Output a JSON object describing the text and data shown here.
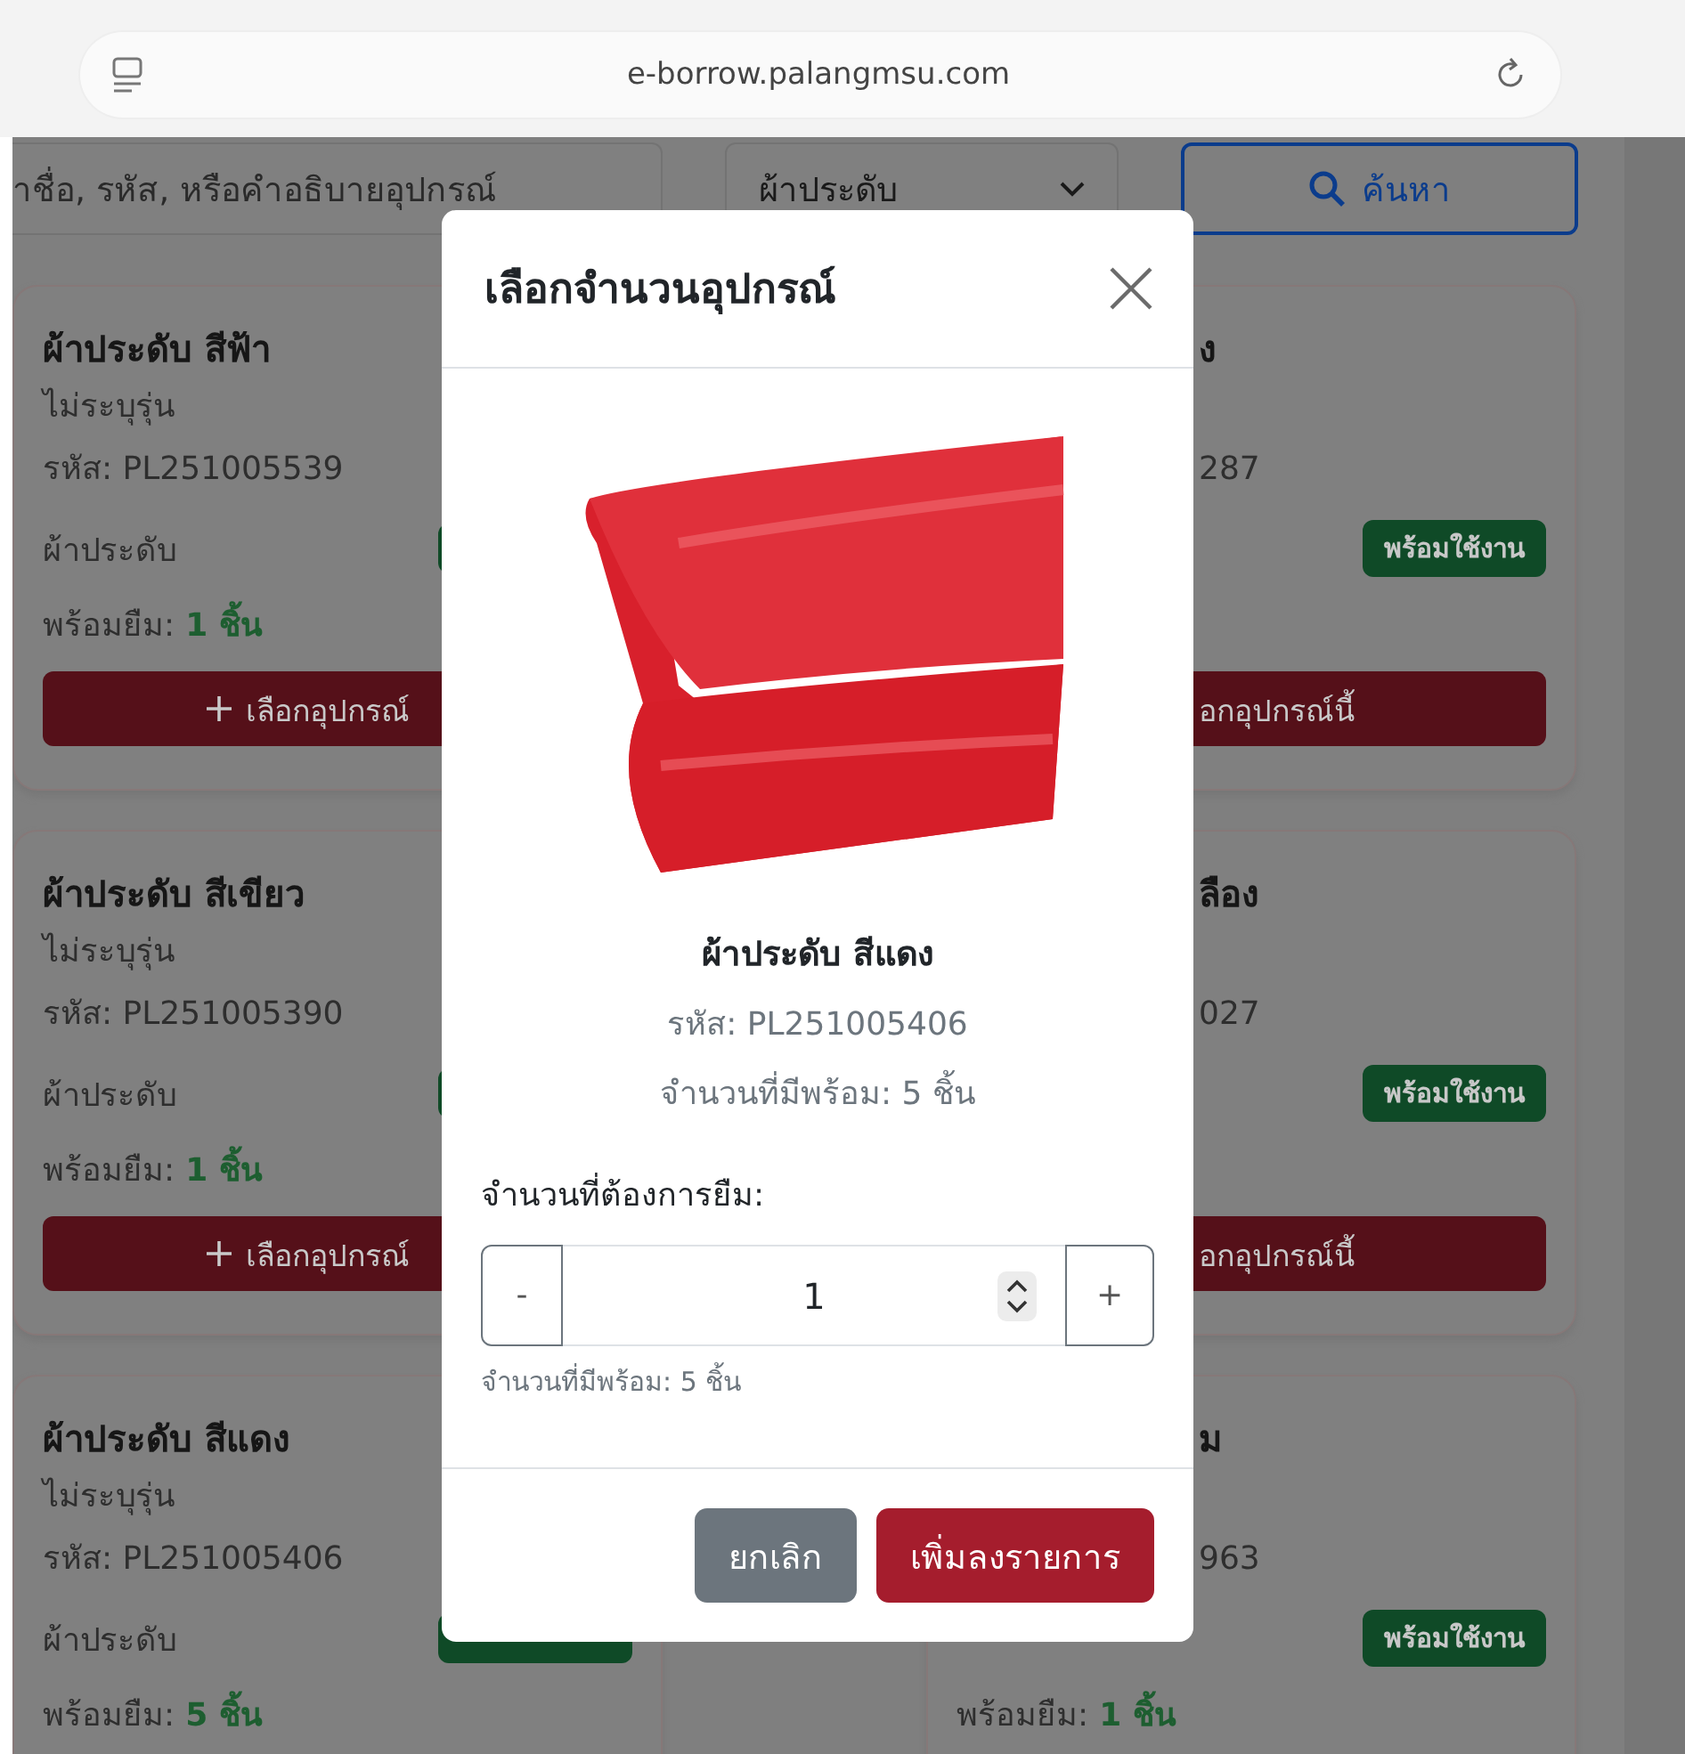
{
  "browser": {
    "url": "e-borrow.palangmsu.com"
  },
  "filters": {
    "search_placeholder": "าชื่อ, รหัส, หรือคำอธิบายอุปกรณ์",
    "category": "ผ้าประดับ",
    "search_button": "ค้นหา"
  },
  "cards_left": [
    {
      "title": "ผ้าประดับ สีฟ้า",
      "model": "ไม่ระบุรุ่น",
      "code": "รหัส: PL251005539",
      "category": "ผ้าประดับ",
      "available_label": "พร้อมยืม:",
      "available_count": "1 ชิ้น",
      "button": "เลือกอุปกรณ์"
    },
    {
      "title": "ผ้าประดับ สีเขียว",
      "model": "ไม่ระบุรุ่น",
      "code": "รหัส: PL251005390",
      "category": "ผ้าประดับ",
      "available_label": "พร้อมยืม:",
      "available_count": "1 ชิ้น",
      "button": "เลือกอุปกรณ์"
    },
    {
      "title": "ผ้าประดับ สีแดง",
      "model": "ไม่ระบุรุ่น",
      "code": "รหัส: PL251005406",
      "category": "ผ้าประดับ",
      "available_label": "พร้อมยืม:",
      "available_count": "5 ชิ้น"
    }
  ],
  "cards_right": [
    {
      "title": "ง",
      "code": "287",
      "badge": "พร้อมใช้งาน",
      "button": "อกอุปกรณ์นี้"
    },
    {
      "title": "ลือง",
      "code": "027",
      "badge": "พร้อมใช้งาน",
      "button": "อกอุปกรณ์นี้"
    },
    {
      "title": "ม",
      "code": "963",
      "badge": "พร้อมใช้งาน",
      "available_label": "พร้อมยืม:",
      "available_count": "1 ชิ้น"
    }
  ],
  "modal": {
    "title": "เลือกจำนวนอุปกรณ์",
    "item_name": "ผ้าประดับ สีแดง",
    "code": "รหัส: PL251005406",
    "stock": "จำนวนที่มีพร้อม: 5 ชิ้น",
    "quantity_label": "จำนวนที่ต้องการยืม:",
    "minus": "-",
    "quantity": "1",
    "plus": "+",
    "hint": "จำนวนที่มีพร้อม: 5 ชิ้น",
    "cancel": "ยกเลิก",
    "confirm": "เพิ่มลงรายการ"
  }
}
